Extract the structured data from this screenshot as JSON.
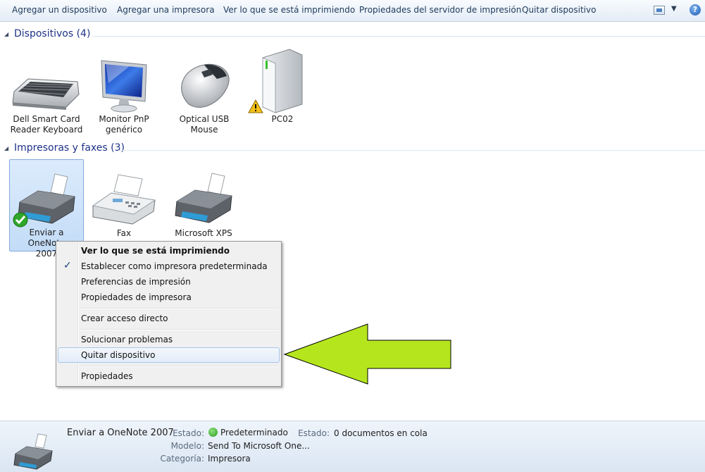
{
  "toolbar": {
    "items": [
      "Agregar un dispositivo",
      "Agregar una impresora",
      "Ver lo que se está imprimiendo",
      "Propiedades del servidor de impresión",
      "Quitar dispositivo"
    ],
    "view_icon": "view-options-icon",
    "help_icon": "help-icon",
    "help_glyph": "?"
  },
  "groups": {
    "devices": {
      "title": "Dispositivos (4)",
      "items": [
        {
          "line1": "Dell Smart Card",
          "line2": "Reader Keyboard",
          "icon": "keyboard-icon"
        },
        {
          "line1": "Monitor PnP",
          "line2": "genérico",
          "icon": "monitor-icon"
        },
        {
          "line1": "Optical USB",
          "line2": "Mouse",
          "icon": "mouse-icon"
        },
        {
          "line1": "PC02",
          "line2": "",
          "icon": "computer-tower-icon",
          "warning": true
        }
      ]
    },
    "printers": {
      "title": "Impresoras y faxes (3)",
      "items": [
        {
          "line1": "Enviar a OneNote",
          "line2": "2007",
          "icon": "printer-icon",
          "default": true,
          "selected": true
        },
        {
          "line1": "Fax",
          "line2": "",
          "icon": "fax-icon"
        },
        {
          "line1": "Microsoft XPS",
          "line2": "",
          "icon": "printer-icon"
        }
      ]
    }
  },
  "context_menu": {
    "items": [
      "Ver lo que se está imprimiendo",
      "Establecer como impresora predeterminada",
      "Preferencias de impresión",
      "Propiedades de impresora",
      "Crear acceso directo",
      "Solucionar problemas",
      "Quitar dispositivo",
      "Propiedades"
    ],
    "checked_item": "Establecer como impresora predeterminada",
    "highlighted_item": "Quitar dispositivo",
    "check_glyph": "✓"
  },
  "details": {
    "name": "Enviar a OneNote 2007",
    "estado_label": "Estado:",
    "estado_value": "Predeterminado",
    "estado2_label": "Estado:",
    "estado2_value": "0 documentos en cola",
    "modelo_label": "Modelo:",
    "modelo_value": "Send To Microsoft One...",
    "categoria_label": "Categoría:",
    "categoria_value": "Impresora"
  },
  "colors": {
    "toolbar_text": "#1e395b",
    "group_title": "#1e3287",
    "arrow_fill": "#b5e61d",
    "selection": "#c3dcf7"
  }
}
